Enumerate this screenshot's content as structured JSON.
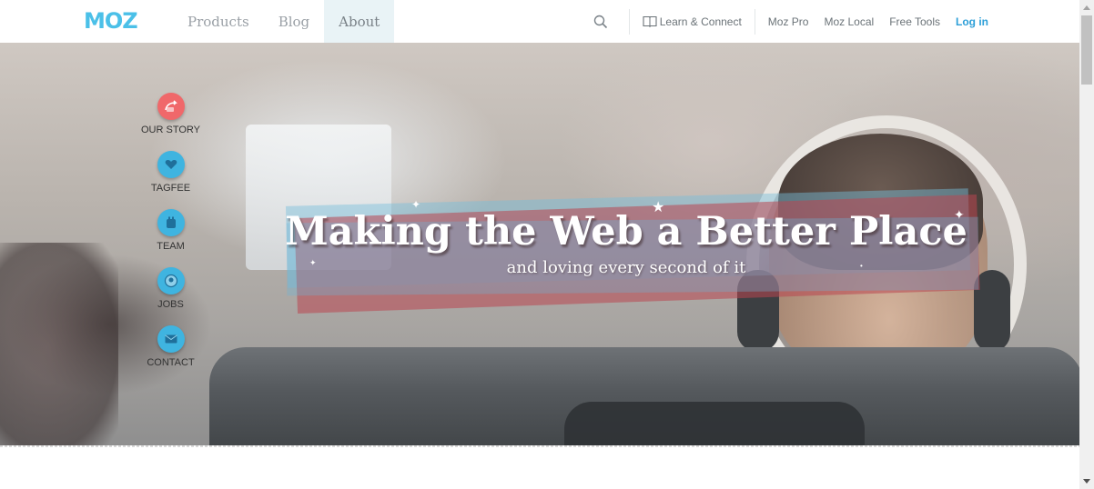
{
  "header": {
    "logo_text": "MOZ",
    "nav": [
      {
        "label": "Products"
      },
      {
        "label": "Blog"
      },
      {
        "label": "About",
        "active": true
      }
    ],
    "search_icon": "search-icon",
    "learn_label": "Learn & Connect",
    "links": [
      "Moz Pro",
      "Moz Local",
      "Free Tools"
    ],
    "login_label": "Log in"
  },
  "hero": {
    "title": "Making the Web a Better Place",
    "subtitle": "and loving every second of it"
  },
  "sidenav": [
    {
      "label": "OUR STORY",
      "icon": "story-icon",
      "color": "#f0686a"
    },
    {
      "label": "TAGFEE",
      "icon": "heart-icon",
      "color": "#3fb4e0"
    },
    {
      "label": "TEAM",
      "icon": "team-icon",
      "color": "#3fb4e0"
    },
    {
      "label": "JOBS",
      "icon": "jobs-icon",
      "color": "#3fb4e0"
    },
    {
      "label": "CONTACT",
      "icon": "mail-icon",
      "color": "#3fb4e0"
    }
  ],
  "colors": {
    "brand": "#4bc0e8",
    "login": "#2d9fd8",
    "active_tab_bg": "#e9f3f6"
  }
}
